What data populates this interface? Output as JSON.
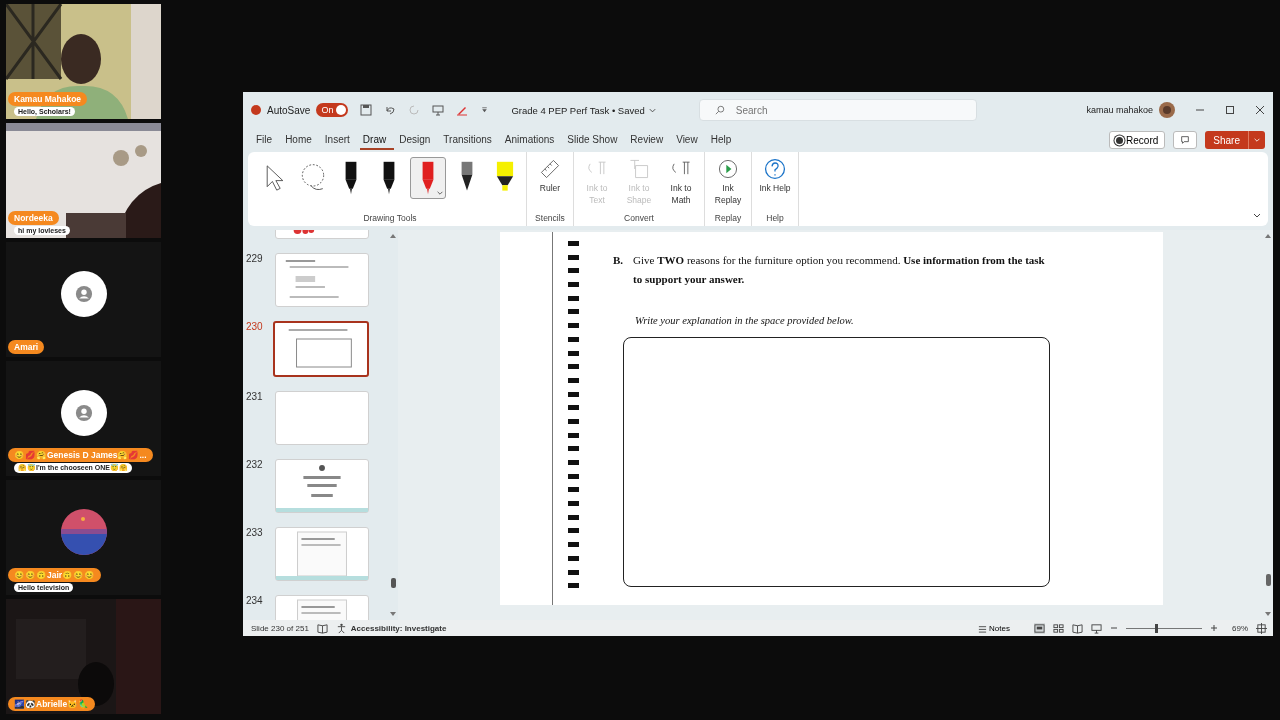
{
  "participants": [
    {
      "name": "Kamau Mahakoe",
      "message": "Hello, Scholars!",
      "kind": "video"
    },
    {
      "name": "Nordeeka",
      "message": "hi my lovleses",
      "kind": "video-room"
    },
    {
      "name": "Amari",
      "kind": "avatar"
    },
    {
      "name": "😊💋🤗Genesis D James🤗💋...",
      "message": "🤗😇I'm the chooseen ONE😇🤗",
      "kind": "avatar"
    },
    {
      "name": "😊😊🙃Jair🙃😊😊",
      "message": "Hello television",
      "kind": "image-avatar"
    },
    {
      "name": "🌌🐼Abrielle🐱🦜",
      "kind": "video-dark"
    }
  ],
  "window": {
    "autosave_label": "AutoSave",
    "autosave_state": "On",
    "autosave_on": true,
    "title": "Grade 4 PEP Perf Task • Saved",
    "search": {
      "placeholder": "Search"
    },
    "user": "kamau mahakoe"
  },
  "tabs": [
    {
      "label": "File",
      "selected": false
    },
    {
      "label": "Home",
      "selected": false
    },
    {
      "label": "Insert",
      "selected": false
    },
    {
      "label": "Draw",
      "selected": true
    },
    {
      "label": "Design",
      "selected": false
    },
    {
      "label": "Transitions",
      "selected": false
    },
    {
      "label": "Animations",
      "selected": false
    },
    {
      "label": "Slide Show",
      "selected": false
    },
    {
      "label": "Review",
      "selected": false
    },
    {
      "label": "View",
      "selected": false
    },
    {
      "label": "Help",
      "selected": false
    }
  ],
  "actions": {
    "record": "Record",
    "share": "Share"
  },
  "ribbon": {
    "drawing_tools": {
      "label": "Drawing Tools",
      "tools": [
        {
          "kind": "select",
          "selected": false
        },
        {
          "kind": "lasso",
          "selected": false
        },
        {
          "kind": "pen",
          "color": "#111111",
          "selected": false
        },
        {
          "kind": "pen",
          "color": "#111111",
          "selected": false
        },
        {
          "kind": "pen",
          "color": "#e02020",
          "selected": true
        },
        {
          "kind": "pencil",
          "color": "#777777",
          "selected": false
        },
        {
          "kind": "highlighter",
          "color": "#f5f000",
          "selected": false
        }
      ]
    },
    "groups": [
      {
        "label": "Stencils",
        "buttons": [
          {
            "kind": "ruler",
            "label": "Ruler",
            "disabled": false
          }
        ]
      },
      {
        "label": "Convert",
        "buttons": [
          {
            "kind": "ink-text",
            "label": "Ink to Text",
            "disabled": true
          },
          {
            "kind": "ink-shape",
            "label": "Ink to Shape",
            "disabled": true
          },
          {
            "kind": "ink-math",
            "label": "Ink to Math",
            "disabled": false
          }
        ]
      },
      {
        "label": "Replay",
        "buttons": [
          {
            "kind": "replay",
            "label": "Ink Replay",
            "disabled": false
          }
        ]
      },
      {
        "label": "Help",
        "buttons": [
          {
            "kind": "help",
            "label": "Ink Help",
            "disabled": false
          }
        ]
      }
    ]
  },
  "thumbnails": [
    {
      "kind": "marks",
      "selected": false
    },
    {
      "number": "229",
      "kind": "text",
      "selected": false
    },
    {
      "number": "230",
      "kind": "box",
      "selected": true
    },
    {
      "number": "231",
      "kind": "blank",
      "selected": false
    },
    {
      "number": "232",
      "kind": "cover",
      "selected": false
    },
    {
      "number": "233",
      "kind": "doc",
      "selected": false
    },
    {
      "number": "234",
      "kind": "doc",
      "selected": false
    }
  ],
  "slide": {
    "marker": "B.",
    "question": "Give **TWO** reasons for the furniture option you recommend. **Use information from the task to support your answer.**",
    "instruction": "Write your explanation in the space provided below."
  },
  "status_bar": {
    "slide": "Slide 230 of 251",
    "accessibility": "Accessibility: Investigate",
    "notes": "Notes",
    "zoom": "69%",
    "zoom_level": {
      "level": 0.4
    }
  }
}
